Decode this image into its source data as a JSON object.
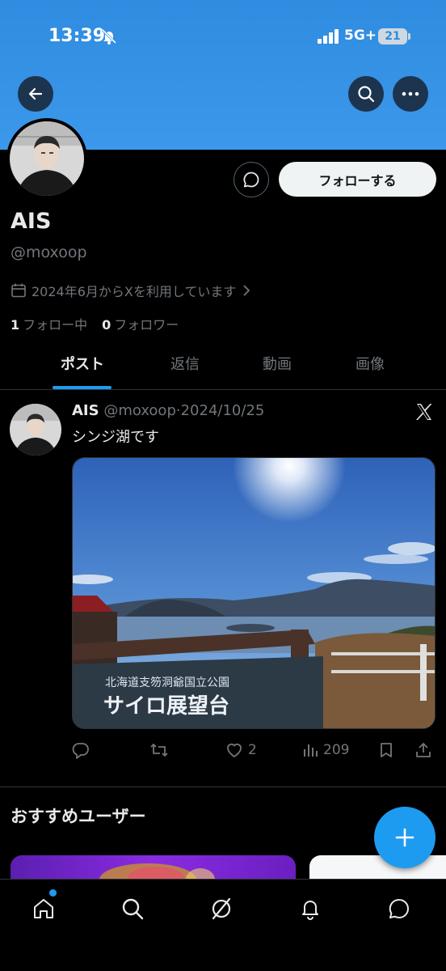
{
  "status_bar": {
    "time": "13:39",
    "network": "5G+",
    "battery": "21"
  },
  "profile": {
    "name": "AIS",
    "handle": "@moxoop",
    "joined": "2024年6月からXを利用しています",
    "following_count": "1",
    "following_label": "フォロー中",
    "followers_count": "0",
    "followers_label": "フォロワー",
    "follow_button": "フォローする"
  },
  "tabs": [
    {
      "label": "ポスト",
      "active": true
    },
    {
      "label": "返信"
    },
    {
      "label": "動画"
    },
    {
      "label": "画像"
    }
  ],
  "post": {
    "author": "AIS",
    "handle": "@moxoop",
    "separator": "·",
    "date": "2024/10/25",
    "text": "シンジ湖です",
    "image_sign_line1": "北海道支笏洞爺国立公園",
    "image_sign_line2": "サイロ展望台",
    "likes": "2",
    "views": "209"
  },
  "suggestions": {
    "title": "おすすめユーザー"
  },
  "colors": {
    "accent": "#1d9bf0",
    "banner": "#3b98ea",
    "muted": "#71767b",
    "text": "#e7e9ea"
  },
  "icons": [
    "back-arrow-icon",
    "search-icon",
    "more-icon",
    "message-icon",
    "calendar-icon",
    "chevron-right-icon",
    "x-logo-icon",
    "reply-icon",
    "retweet-icon",
    "like-icon",
    "views-icon",
    "bookmark-icon",
    "share-icon",
    "plus-icon",
    "home-icon",
    "explore-icon",
    "grok-icon",
    "notifications-icon",
    "messages-icon"
  ]
}
